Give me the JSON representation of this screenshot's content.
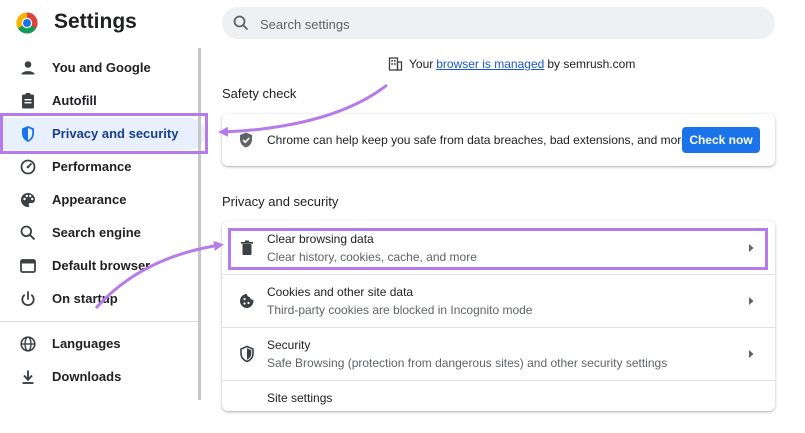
{
  "app": {
    "title": "Settings"
  },
  "search": {
    "placeholder": "Search settings"
  },
  "sidebar": {
    "items": [
      {
        "label": "You and Google",
        "icon": "person-icon"
      },
      {
        "label": "Autofill",
        "icon": "clipboard-icon"
      },
      {
        "label": "Privacy and security",
        "icon": "shield-icon",
        "active": true
      },
      {
        "label": "Performance",
        "icon": "speedometer-icon"
      },
      {
        "label": "Appearance",
        "icon": "palette-icon"
      },
      {
        "label": "Search engine",
        "icon": "search-icon"
      },
      {
        "label": "Default browser",
        "icon": "browser-window-icon"
      },
      {
        "label": "On startup",
        "icon": "power-icon"
      },
      {
        "label": "Languages",
        "icon": "globe-icon"
      },
      {
        "label": "Downloads",
        "icon": "download-icon"
      }
    ]
  },
  "managed": {
    "prefix": "Your",
    "link": "browser is managed",
    "suffix": "by semrush.com"
  },
  "safety_check": {
    "title": "Safety check",
    "message": "Chrome can help keep you safe from data breaches, bad extensions, and more",
    "button": "Check now"
  },
  "privacy": {
    "title": "Privacy and security",
    "rows": [
      {
        "title": "Clear browsing data",
        "subtitle": "Clear history, cookies, cache, and more",
        "icon": "trash-icon"
      },
      {
        "title": "Cookies and other site data",
        "subtitle": "Third-party cookies are blocked in Incognito mode",
        "icon": "cookie-icon"
      },
      {
        "title": "Security",
        "subtitle": "Safe Browsing (protection from dangerous sites) and other security settings",
        "icon": "security-shield-icon"
      },
      {
        "title": "Site settings",
        "subtitle": "",
        "icon": "site-settings-icon"
      }
    ]
  },
  "colors": {
    "accent": "#1a73e8",
    "annotation": "#b57bea",
    "active_bg": "#e8f0fe"
  }
}
